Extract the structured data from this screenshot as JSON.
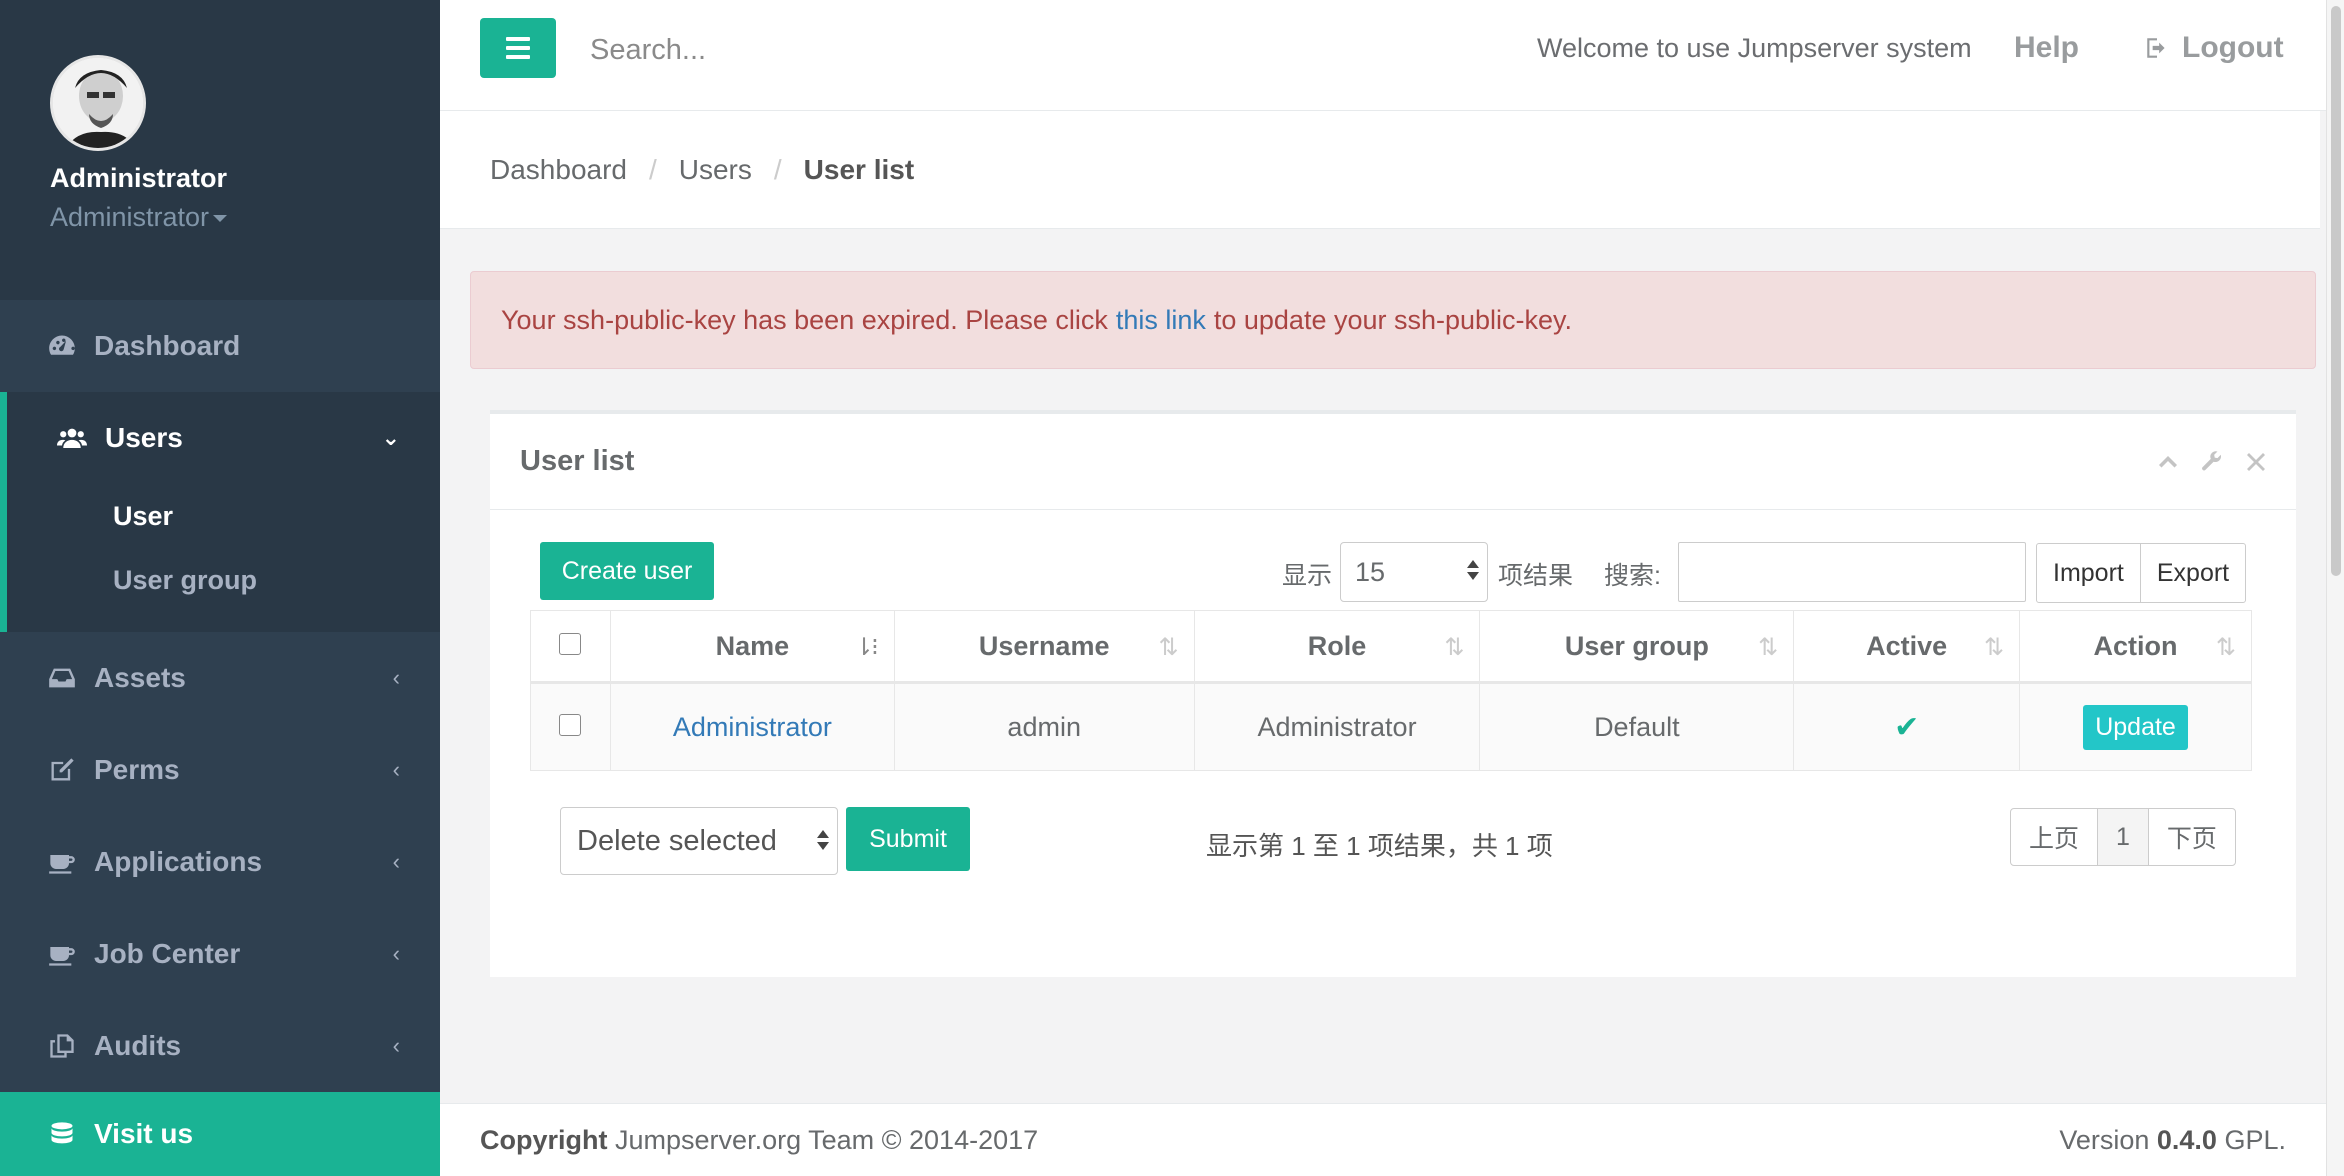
{
  "sidebar": {
    "profile": {
      "name": "Administrator",
      "role": "Administrator"
    },
    "items": [
      {
        "label": "Dashboard",
        "icon": "dashboard-icon"
      },
      {
        "label": "Users",
        "icon": "users-icon",
        "expanded": true,
        "children": [
          {
            "label": "User",
            "active": true
          },
          {
            "label": "User group"
          }
        ]
      },
      {
        "label": "Assets",
        "icon": "inbox-icon"
      },
      {
        "label": "Perms",
        "icon": "edit-icon"
      },
      {
        "label": "Applications",
        "icon": "coffee-icon"
      },
      {
        "label": "Job Center",
        "icon": "coffee-icon"
      },
      {
        "label": "Audits",
        "icon": "copy-icon"
      },
      {
        "label": "Visit us",
        "icon": "database-icon"
      }
    ]
  },
  "topbar": {
    "search_placeholder": "Search...",
    "welcome": "Welcome to use Jumpserver system",
    "help": "Help",
    "logout": "Logout"
  },
  "breadcrumb": {
    "items": [
      "Dashboard",
      "Users"
    ],
    "current": "User list"
  },
  "alert": {
    "before": "Your ssh-public-key has been expired. Please click",
    "link": "this link",
    "after": "to update your ssh-public-key."
  },
  "panel": {
    "title": "User list",
    "create_button": "Create user",
    "length_label_before": "显示",
    "length_value": "15",
    "length_label_after": "项结果",
    "search_label": "搜索:",
    "import": "Import",
    "export": "Export",
    "columns": [
      "Name",
      "Username",
      "Role",
      "User group",
      "Active",
      "Action"
    ],
    "rows": [
      {
        "name": "Administrator",
        "username": "admin",
        "role": "Administrator",
        "group": "Default",
        "active": true,
        "action": "Update"
      }
    ],
    "bulk_action": "Delete selected",
    "submit": "Submit",
    "info": "显示第 1 至 1 项结果，共 1 项",
    "pager": {
      "prev": "上页",
      "page": "1",
      "next": "下页"
    }
  },
  "footer": {
    "copyright_label": "Copyright",
    "copyright_text": "Jumpserver.org Team © 2014-2017",
    "version_label": "Version",
    "version": "0.4.0",
    "license": "GPL."
  },
  "colors": {
    "accent": "#1ab394",
    "sidebar": "#2f4050",
    "alert_bg": "#f2dede",
    "info_button": "#23c6c8"
  }
}
